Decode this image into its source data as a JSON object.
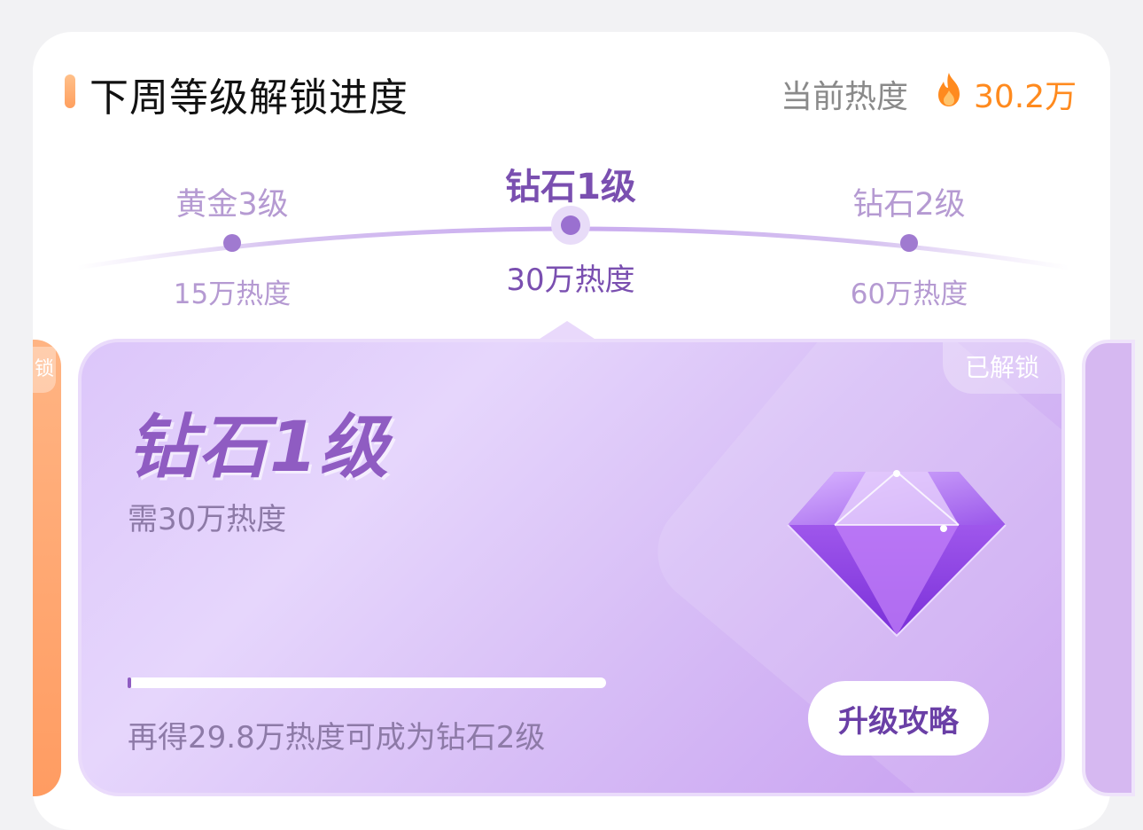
{
  "header": {
    "title": "下周等级解锁进度",
    "heat_label": "当前热度",
    "heat_value": "30.2万",
    "icon": "flame-icon"
  },
  "timeline": {
    "levels": [
      {
        "name": "黄金3级",
        "heat": "15万热度",
        "state": "passed"
      },
      {
        "name": "钻石1级",
        "heat": "30万热度",
        "state": "current"
      },
      {
        "name": "钻石2级",
        "heat": "60万热度",
        "state": "next"
      }
    ]
  },
  "left_peek": {
    "tag": "锁"
  },
  "level_card": {
    "badge": "已解锁",
    "title": "钻石1级",
    "requirement": "需30万热度",
    "icon": "diamond-icon",
    "progress_fraction": 0.005,
    "remaining": "再得29.8万热度可成为钻石2级",
    "button": "升级攻略"
  },
  "colors": {
    "accent_purple": "#8f5cc2",
    "heat_orange": "#ff8a1e",
    "left_card_orange": "#ffa46a",
    "card_purple": "#dcc6fa"
  }
}
